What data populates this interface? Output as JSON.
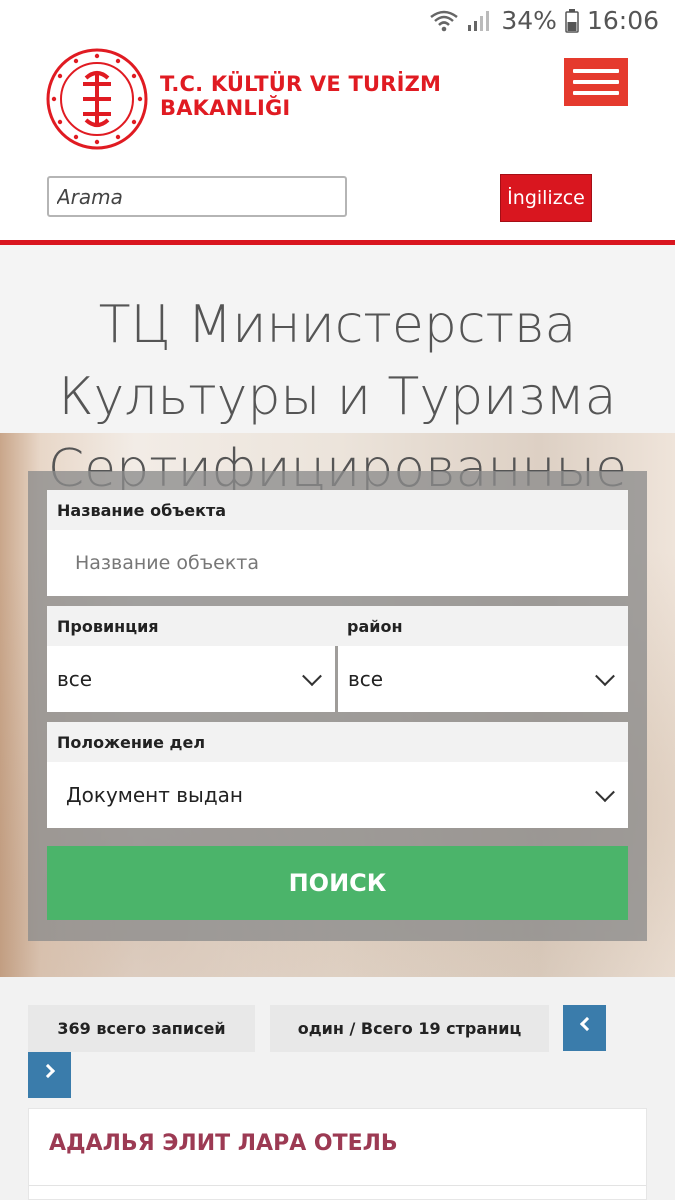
{
  "status": {
    "battery": "34%",
    "time": "16:06"
  },
  "header": {
    "logo_text_line1": "T.C. KÜLTÜR VE TURİZM",
    "logo_text_line2": "BAKANLIĞI",
    "search_placeholder": "Arama",
    "lang_button": "İngilizce"
  },
  "hero": {
    "title": "ТЦ Министерства Культуры и Туризма Сертифицированные"
  },
  "form": {
    "object_name_label": "Название объекта",
    "object_name_placeholder": "Название объекта",
    "province_label": "Провинция",
    "province_value": "все",
    "district_label": "район",
    "district_value": "все",
    "status_label": "Положение дел",
    "status_value": "Документ выдан",
    "search_button": "ПОИСК"
  },
  "results": {
    "total_records": "369 всего записей",
    "page_info": "один / Всего 19 страниц",
    "items": [
      {
        "title": "АДАЛЬЯ ЭЛИТ ЛАРА ОТЕЛЬ"
      }
    ]
  },
  "colors": {
    "brand_red": "#d9161f",
    "menu_red": "#e53a2d",
    "search_green": "#4bb46a",
    "pager_blue": "#3a7cab",
    "result_title": "#9c3a53"
  }
}
